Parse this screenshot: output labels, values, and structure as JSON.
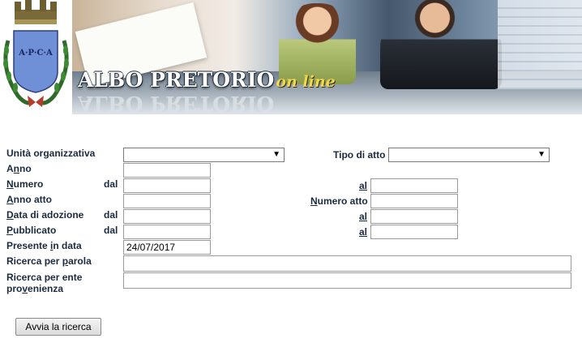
{
  "header": {
    "crest_text": "A·P·C·A",
    "title": "ALBO PRETORIO",
    "subtitle": "on line"
  },
  "form": {
    "unita_label": "Unità organizzativa",
    "unita_value": "",
    "tipo_label": "Tipo di atto",
    "tipo_value": "",
    "anno_label": "Anno",
    "anno_value": "",
    "numero_label": "Numero",
    "numero_dal_label": "dal",
    "numero_dal_value": "",
    "numero_al_label": "al",
    "numero_al_value": "",
    "anno_atto_label": "Anno atto",
    "anno_atto_value": "",
    "numero_atto_label": "Numero atto",
    "numero_atto_value": "",
    "data_adozione_label": "Data di adozione",
    "data_adozione_dal_label": "dal",
    "data_adozione_dal_value": "",
    "data_adozione_al_label": "al",
    "data_adozione_al_value": "",
    "pubblicato_label": "Pubblicato",
    "pubblicato_dal_label": "dal",
    "pubblicato_dal_value": "",
    "pubblicato_al_label": "al",
    "pubblicato_al_value": "",
    "presente_label": "Presente in data",
    "presente_value": "24/07/2017",
    "parola_label": "Ricerca per parola",
    "parola_value": "",
    "ente_label_1": "Ricerca per ente",
    "ente_label_2": "provenienza",
    "ente_value": "",
    "submit_label": "Avvia la ricerca"
  },
  "icons": {
    "dropdown": "chevron-down-icon",
    "crest": "crest-icon"
  },
  "colors": {
    "label": "#1c2a3e",
    "title_sub": "#f0d84a"
  }
}
